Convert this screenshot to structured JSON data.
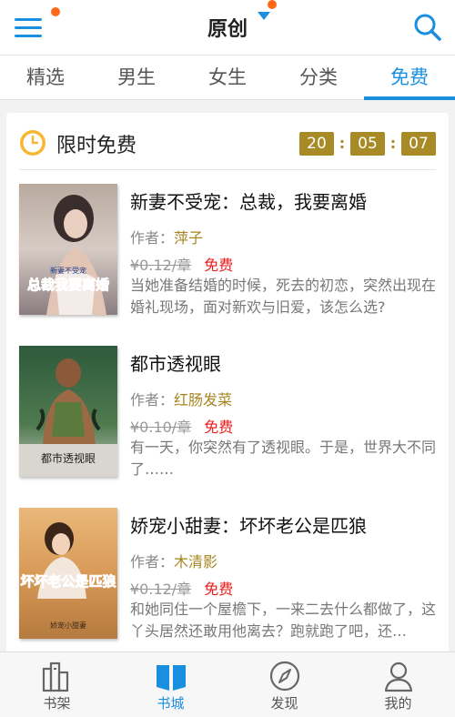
{
  "header": {
    "title": "原创"
  },
  "tabs": [
    {
      "label": "精选"
    },
    {
      "label": "男生"
    },
    {
      "label": "女生"
    },
    {
      "label": "分类"
    },
    {
      "label": "免费"
    }
  ],
  "free_section": {
    "title": "限时免费",
    "timer": {
      "hours": "20",
      "minutes": "05",
      "seconds": "07",
      "separator": ":"
    }
  },
  "books": [
    {
      "title": "新妻不受宠：总裁，我要离婚",
      "author_label": "作者：",
      "author": "萍子",
      "old_price": "¥0.12/章",
      "free_label": "免费",
      "description": "当她准备结婚的时候，死去的初恋，突然出现在婚礼现场，面对新欢与旧爱，该怎么选?",
      "cover_text_small": "新妻不受宠",
      "cover_text_large": "总裁我要离婚"
    },
    {
      "title": "都市透视眼",
      "author_label": "作者：",
      "author": "红肠发菜",
      "old_price": "¥0.10/章",
      "free_label": "免费",
      "description": "有一天，你突然有了透视眼。于是，世界大不同了……",
      "cover_text_large": "都市透视眼"
    },
    {
      "title": "娇宠小甜妻：坏坏老公是匹狼",
      "author_label": "作者：",
      "author": "木清影",
      "old_price": "¥0.12/章",
      "free_label": "免费",
      "description": "和她同住一个屋檐下，一来二去什么都做了，这丫头居然还敢用他离去？跑就跑了吧，还…",
      "cover_text_large": "坏坏老公是匹狼",
      "cover_text_small": "娇宠小甜妻"
    }
  ],
  "bottom_nav": [
    {
      "label": "书架",
      "icon": "bookshelf-icon"
    },
    {
      "label": "书城",
      "icon": "book-open-icon"
    },
    {
      "label": "发现",
      "icon": "compass-icon"
    },
    {
      "label": "我的",
      "icon": "user-icon"
    }
  ],
  "colors": {
    "accent": "#1a8fe0",
    "notify_dot": "#ff6a1a",
    "timer_bg": "#a88b26",
    "free_red": "#ee1c1c",
    "author_gold": "#a6861f"
  }
}
